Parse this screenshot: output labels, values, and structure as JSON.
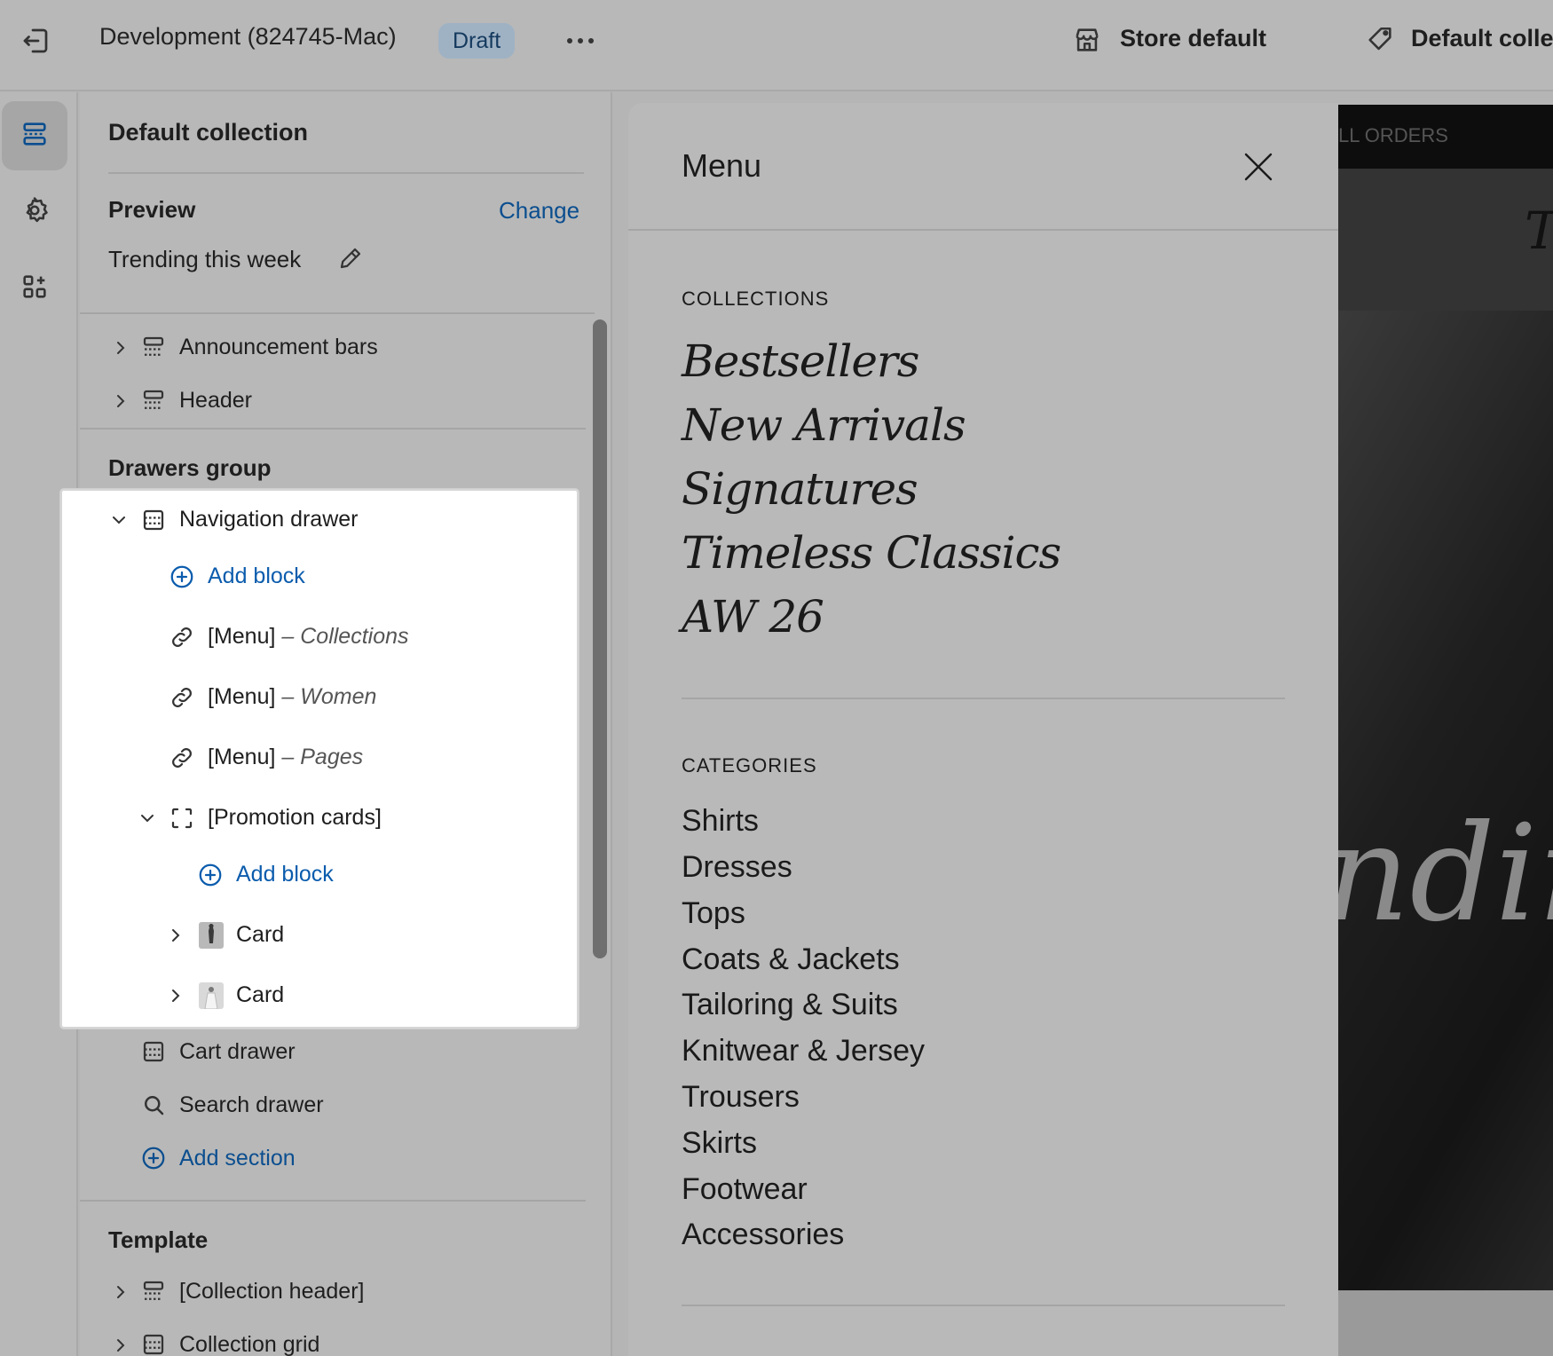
{
  "topbar": {
    "title": "Development (824745-Mac)",
    "badge": "Draft",
    "store_label": "Store default",
    "collection_label": "Default colle"
  },
  "sidebar": {
    "title": "Default collection",
    "preview_label": "Preview",
    "change_label": "Change",
    "preview_value": "Trending this week",
    "header_items": [
      "Announcement bars",
      "Header"
    ],
    "drawers_group_label": "Drawers group",
    "navigation_drawer": "Navigation drawer",
    "add_block": "Add block",
    "menus": [
      {
        "prefix": "[Menu]",
        "suffix": "– Collections"
      },
      {
        "prefix": "[Menu]",
        "suffix": "– Women"
      },
      {
        "prefix": "[Menu]",
        "suffix": "– Pages"
      }
    ],
    "promotion_cards": "[Promotion cards]",
    "add_block_2": "Add block",
    "cards": [
      "Card",
      "Card"
    ],
    "cart_drawer": "Cart drawer",
    "search_drawer": "Search drawer",
    "add_section": "Add section",
    "template_label": "Template",
    "template_items": [
      "[Collection header]",
      "Collection grid"
    ]
  },
  "preview": {
    "menu_title": "Menu",
    "collections_heading": "COLLECTIONS",
    "collections": [
      "Bestsellers",
      "New Arrivals",
      "Signatures",
      "Timeless Classics",
      "AW 26"
    ],
    "categories_heading": "CATEGORIES",
    "categories": [
      "Shirts",
      "Dresses",
      "Tops",
      "Coats & Jackets",
      "Tailoring & Suits",
      "Knitwear & Jersey",
      "Trousers",
      "Skirts",
      "Footwear",
      "Accessories"
    ],
    "announcement": "LL ORDERS",
    "hero_letter": "T",
    "hero_script": "ndin"
  },
  "colors": {
    "accent": "#0b5cad",
    "badge_bg": "#9fb2c4",
    "overlay": "#b5b5b5"
  }
}
